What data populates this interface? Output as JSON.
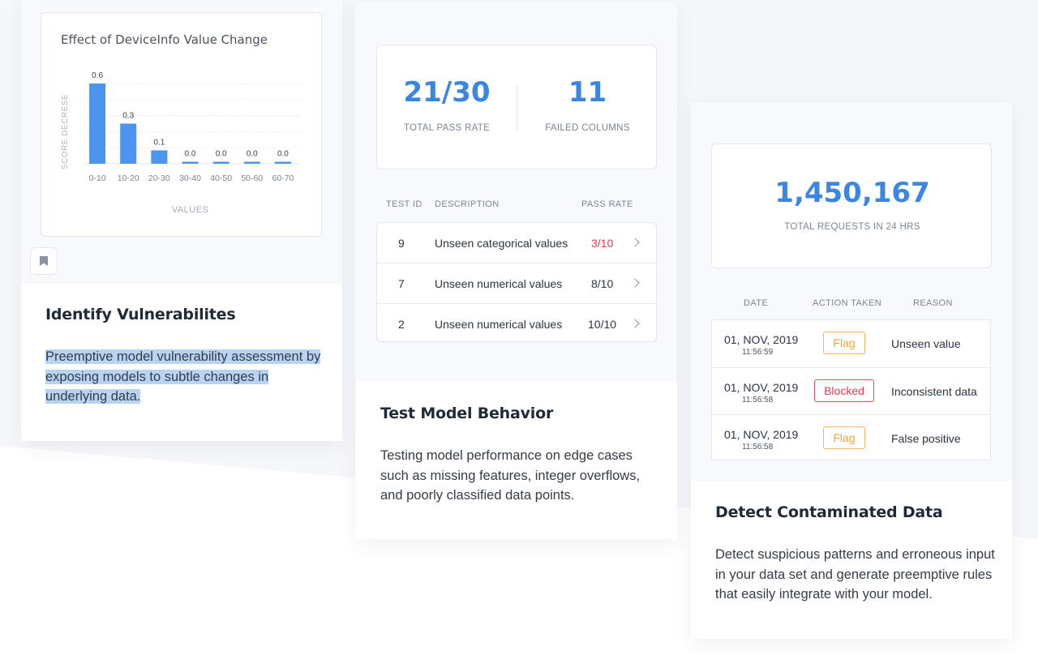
{
  "card1": {
    "chart_data": {
      "type": "bar",
      "title": "Effect of DeviceInfo Value Change",
      "xlabel": "VALUES",
      "ylabel": "SCORE DECRESE",
      "categories": [
        "0-10",
        "10-20",
        "20-30",
        "30-40",
        "40-50",
        "50-60",
        "60-70"
      ],
      "values": [
        0.6,
        0.3,
        0.1,
        0.0,
        0.0,
        0.0,
        0.0
      ],
      "value_labels": [
        "0.6",
        "0.3",
        "0.1",
        "0.0",
        "0.0",
        "0.0",
        "0.0"
      ],
      "ylim": [
        0,
        0.6
      ],
      "grid": true,
      "bar_color": "#4d94ee"
    },
    "bookmark_icon": "bookmark-icon",
    "title": "Identify Vulnerabilites",
    "description": "Preemptive model vulnerability assessment by exposing models to subtle changes in underlying data."
  },
  "card2": {
    "pass_rate": "21/30",
    "pass_rate_label": "TOTAL PASS RATE",
    "failed_columns": "11",
    "failed_columns_label": "FAILED COLUMNS",
    "table": {
      "headers": [
        "TEST ID",
        "DESCRIPTION",
        "PASS RATE"
      ],
      "rows": [
        {
          "id": "9",
          "description": "Unseen categorical values",
          "pass_rate": "3/10",
          "status": "fail"
        },
        {
          "id": "7",
          "description": "Unseen numerical values",
          "pass_rate": "8/10",
          "status": "ok"
        },
        {
          "id": "2",
          "description": "Unseen numerical values",
          "pass_rate": "10/10",
          "status": "ok"
        }
      ]
    },
    "title": "Test Model Behavior",
    "description": "Testing model performance on edge cases such as missing features, integer overflows, and poorly classified data points."
  },
  "card3": {
    "requests": "1,450,167",
    "requests_label": "TOTAL REQUESTS IN 24 HRS",
    "table": {
      "headers": [
        "DATE",
        "ACTION TAKEN",
        "REASON"
      ],
      "rows": [
        {
          "date": "01, NOV, 2019",
          "time": "11:56:59",
          "action": "Flag",
          "action_type": "flag",
          "reason": "Unseen value"
        },
        {
          "date": "01, NOV, 2019",
          "time": "11:56:58",
          "action": "Blocked",
          "action_type": "blocked",
          "reason": "Inconsistent data"
        },
        {
          "date": "01, NOV, 2019",
          "time": "11:56:58",
          "action": "Flag",
          "action_type": "flag",
          "reason": "False positive"
        }
      ]
    },
    "title": "Detect Contaminated Data",
    "description": "Detect suspicious patterns and erroneous input in your data set and generate preemptive rules that easily integrate with your model."
  },
  "colors": {
    "accent": "#3b86e3",
    "fail": "#e23b4d",
    "flag": "#f2a43a",
    "highlight": "#b9d3f3"
  }
}
